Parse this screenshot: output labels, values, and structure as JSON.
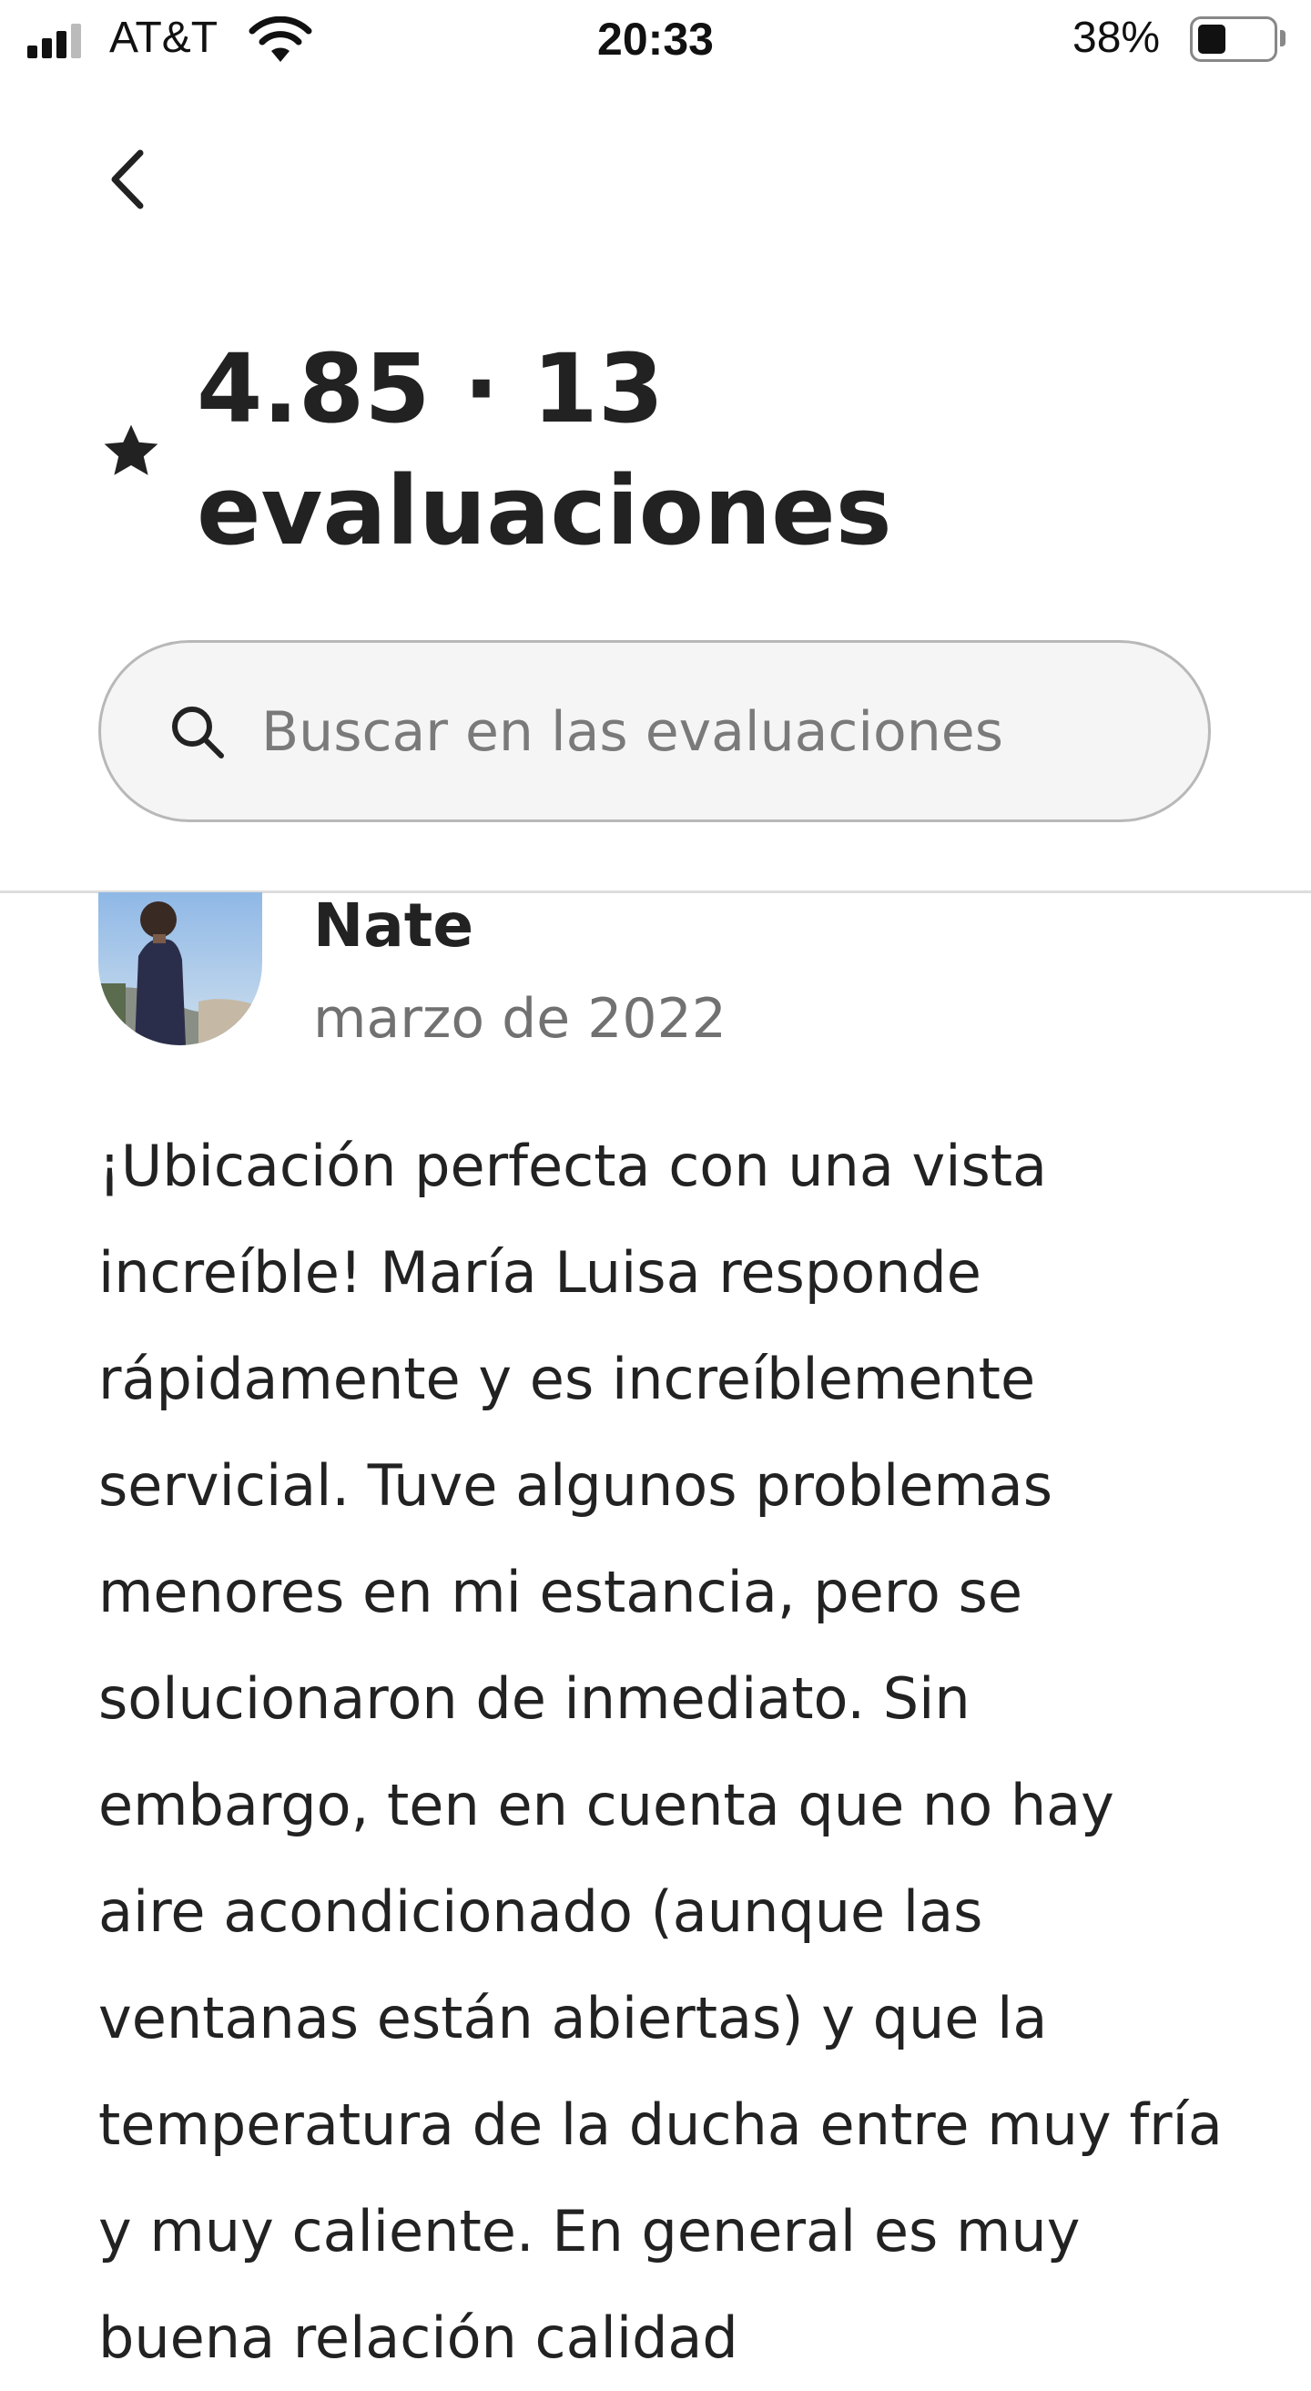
{
  "status_bar": {
    "carrier": "AT&T",
    "time": "20:33",
    "battery_percent": "38%",
    "battery_level": 0.38,
    "signal_bars": 3
  },
  "header": {
    "back_icon": "chevron-left-icon",
    "star_icon": "star-icon",
    "rating_title": "4.85 · 13 evaluaciones"
  },
  "search": {
    "icon": "search-icon",
    "placeholder": "Buscar en las evaluaciones",
    "value": ""
  },
  "review": {
    "name": "Nate",
    "date": "marzo de 2022",
    "text": "¡Ubicación perfecta con una vista increíble! María Luisa responde rápidamente y es increíblemente servicial. Tuve algunos problemas menores en mi estancia, pero se solucionaron de inmediato. Sin embargo, ten en cuenta que no hay aire acondicionado (aunque las ventanas están abiertas) y que la temperatura de la ducha entre muy fría y muy caliente. En general es muy buena relación calidad"
  },
  "colors": {
    "text_primary": "#222222",
    "text_secondary": "#717171",
    "search_border": "#b8b8b8",
    "search_bg": "#f5f5f5",
    "divider": "#dddddd"
  }
}
